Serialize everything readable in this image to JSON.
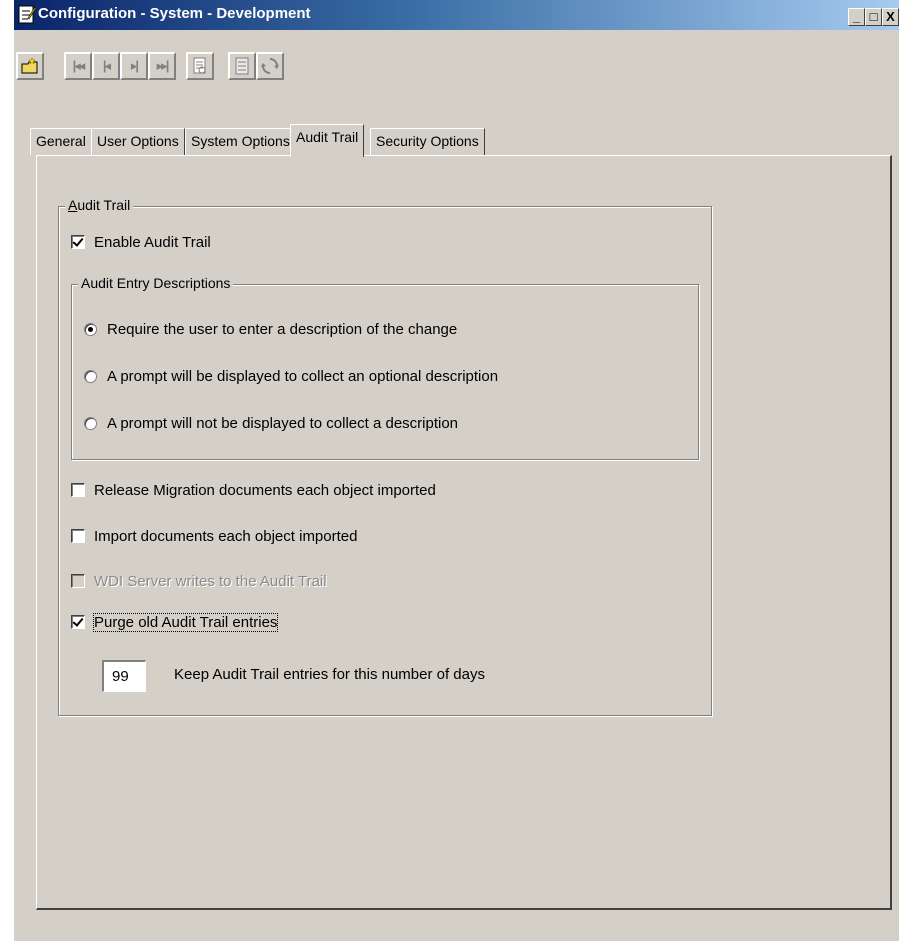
{
  "window": {
    "title": "Configuration - System - Development",
    "controls": {
      "minimize": "_",
      "maximize": "□",
      "close": "X"
    }
  },
  "toolbar": {
    "buttons": [
      {
        "name": "new-button",
        "icon": "new-folder-icon"
      },
      {
        "name": "first-record-button",
        "icon": "first-record-icon"
      },
      {
        "name": "previous-record-button",
        "icon": "previous-record-icon"
      },
      {
        "name": "next-record-button",
        "icon": "next-record-icon"
      },
      {
        "name": "last-record-button",
        "icon": "last-record-icon"
      },
      {
        "name": "print-preview-button",
        "icon": "document-icon"
      },
      {
        "name": "list-button",
        "icon": "list-icon"
      },
      {
        "name": "refresh-button",
        "icon": "refresh-icon"
      }
    ]
  },
  "tabs": [
    {
      "label": "General"
    },
    {
      "label": "User Options"
    },
    {
      "label": "System Options"
    },
    {
      "label": "Audit Trail",
      "active": true
    },
    {
      "label": "Security Options"
    }
  ],
  "audit_trail": {
    "group_label": "Audit Trail",
    "enable_label": "Enable Audit Trail",
    "enable_checked": true,
    "descriptions": {
      "group_label": "Audit Entry Descriptions",
      "options": [
        {
          "label": "Require the user to enter a description of the change",
          "selected": true
        },
        {
          "label": "A prompt will be displayed to collect an optional description",
          "selected": false
        },
        {
          "label": "A prompt will not be displayed to collect a description",
          "selected": false
        }
      ]
    },
    "release_migration_label": "Release Migration documents each object imported",
    "release_migration_checked": false,
    "import_documents_label": "Import documents each object imported",
    "import_documents_checked": false,
    "wdi_server_label": "WDI Server writes to the Audit Trail",
    "wdi_server_checked": false,
    "wdi_server_disabled": true,
    "purge_label": "Purge old Audit Trail entries",
    "purge_checked": true,
    "keep_days_value": "99",
    "keep_days_label": "Keep Audit Trail entries for this number of days"
  },
  "colors": {
    "face": "#d4d0c8",
    "titlebar_start": "#0a246a",
    "titlebar_end": "#a6caf0"
  }
}
